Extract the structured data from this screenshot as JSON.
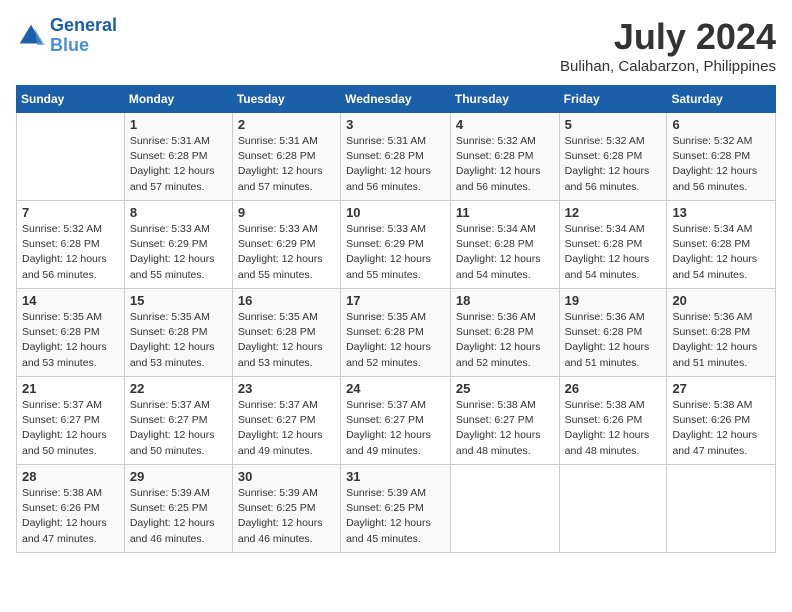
{
  "header": {
    "logo_line1": "General",
    "logo_line2": "Blue",
    "month": "July 2024",
    "location": "Bulihan, Calabarzon, Philippines"
  },
  "days_of_week": [
    "Sunday",
    "Monday",
    "Tuesday",
    "Wednesday",
    "Thursday",
    "Friday",
    "Saturday"
  ],
  "weeks": [
    [
      {
        "num": "",
        "info": ""
      },
      {
        "num": "1",
        "info": "Sunrise: 5:31 AM\nSunset: 6:28 PM\nDaylight: 12 hours\nand 57 minutes."
      },
      {
        "num": "2",
        "info": "Sunrise: 5:31 AM\nSunset: 6:28 PM\nDaylight: 12 hours\nand 57 minutes."
      },
      {
        "num": "3",
        "info": "Sunrise: 5:31 AM\nSunset: 6:28 PM\nDaylight: 12 hours\nand 56 minutes."
      },
      {
        "num": "4",
        "info": "Sunrise: 5:32 AM\nSunset: 6:28 PM\nDaylight: 12 hours\nand 56 minutes."
      },
      {
        "num": "5",
        "info": "Sunrise: 5:32 AM\nSunset: 6:28 PM\nDaylight: 12 hours\nand 56 minutes."
      },
      {
        "num": "6",
        "info": "Sunrise: 5:32 AM\nSunset: 6:28 PM\nDaylight: 12 hours\nand 56 minutes."
      }
    ],
    [
      {
        "num": "7",
        "info": "Sunrise: 5:32 AM\nSunset: 6:28 PM\nDaylight: 12 hours\nand 56 minutes."
      },
      {
        "num": "8",
        "info": "Sunrise: 5:33 AM\nSunset: 6:29 PM\nDaylight: 12 hours\nand 55 minutes."
      },
      {
        "num": "9",
        "info": "Sunrise: 5:33 AM\nSunset: 6:29 PM\nDaylight: 12 hours\nand 55 minutes."
      },
      {
        "num": "10",
        "info": "Sunrise: 5:33 AM\nSunset: 6:29 PM\nDaylight: 12 hours\nand 55 minutes."
      },
      {
        "num": "11",
        "info": "Sunrise: 5:34 AM\nSunset: 6:28 PM\nDaylight: 12 hours\nand 54 minutes."
      },
      {
        "num": "12",
        "info": "Sunrise: 5:34 AM\nSunset: 6:28 PM\nDaylight: 12 hours\nand 54 minutes."
      },
      {
        "num": "13",
        "info": "Sunrise: 5:34 AM\nSunset: 6:28 PM\nDaylight: 12 hours\nand 54 minutes."
      }
    ],
    [
      {
        "num": "14",
        "info": "Sunrise: 5:35 AM\nSunset: 6:28 PM\nDaylight: 12 hours\nand 53 minutes."
      },
      {
        "num": "15",
        "info": "Sunrise: 5:35 AM\nSunset: 6:28 PM\nDaylight: 12 hours\nand 53 minutes."
      },
      {
        "num": "16",
        "info": "Sunrise: 5:35 AM\nSunset: 6:28 PM\nDaylight: 12 hours\nand 53 minutes."
      },
      {
        "num": "17",
        "info": "Sunrise: 5:35 AM\nSunset: 6:28 PM\nDaylight: 12 hours\nand 52 minutes."
      },
      {
        "num": "18",
        "info": "Sunrise: 5:36 AM\nSunset: 6:28 PM\nDaylight: 12 hours\nand 52 minutes."
      },
      {
        "num": "19",
        "info": "Sunrise: 5:36 AM\nSunset: 6:28 PM\nDaylight: 12 hours\nand 51 minutes."
      },
      {
        "num": "20",
        "info": "Sunrise: 5:36 AM\nSunset: 6:28 PM\nDaylight: 12 hours\nand 51 minutes."
      }
    ],
    [
      {
        "num": "21",
        "info": "Sunrise: 5:37 AM\nSunset: 6:27 PM\nDaylight: 12 hours\nand 50 minutes."
      },
      {
        "num": "22",
        "info": "Sunrise: 5:37 AM\nSunset: 6:27 PM\nDaylight: 12 hours\nand 50 minutes."
      },
      {
        "num": "23",
        "info": "Sunrise: 5:37 AM\nSunset: 6:27 PM\nDaylight: 12 hours\nand 49 minutes."
      },
      {
        "num": "24",
        "info": "Sunrise: 5:37 AM\nSunset: 6:27 PM\nDaylight: 12 hours\nand 49 minutes."
      },
      {
        "num": "25",
        "info": "Sunrise: 5:38 AM\nSunset: 6:27 PM\nDaylight: 12 hours\nand 48 minutes."
      },
      {
        "num": "26",
        "info": "Sunrise: 5:38 AM\nSunset: 6:26 PM\nDaylight: 12 hours\nand 48 minutes."
      },
      {
        "num": "27",
        "info": "Sunrise: 5:38 AM\nSunset: 6:26 PM\nDaylight: 12 hours\nand 47 minutes."
      }
    ],
    [
      {
        "num": "28",
        "info": "Sunrise: 5:38 AM\nSunset: 6:26 PM\nDaylight: 12 hours\nand 47 minutes."
      },
      {
        "num": "29",
        "info": "Sunrise: 5:39 AM\nSunset: 6:25 PM\nDaylight: 12 hours\nand 46 minutes."
      },
      {
        "num": "30",
        "info": "Sunrise: 5:39 AM\nSunset: 6:25 PM\nDaylight: 12 hours\nand 46 minutes."
      },
      {
        "num": "31",
        "info": "Sunrise: 5:39 AM\nSunset: 6:25 PM\nDaylight: 12 hours\nand 45 minutes."
      },
      {
        "num": "",
        "info": ""
      },
      {
        "num": "",
        "info": ""
      },
      {
        "num": "",
        "info": ""
      }
    ]
  ]
}
